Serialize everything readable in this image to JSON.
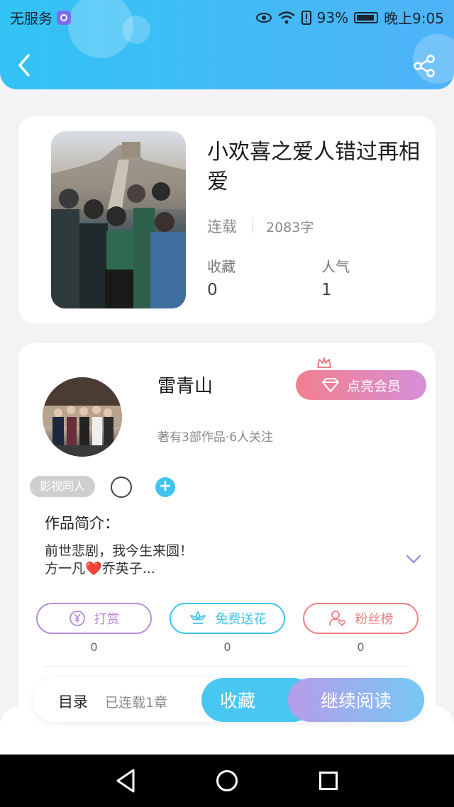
{
  "status_bar": {
    "carrier": "无服务",
    "battery": "93%",
    "time": "晚上9:05"
  },
  "book": {
    "title": "小欢喜之爱人错过再相爱",
    "status": "连载",
    "word_count": "2083字",
    "favorites_label": "收藏",
    "favorites_value": "0",
    "popularity_label": "人气",
    "popularity_value": "1"
  },
  "author": {
    "name": "雷青山",
    "subtitle": "著有3部作品·6人关注",
    "vip_label": "点亮会员",
    "tag": "影视同人",
    "intro_title": "作品简介：",
    "intro_line1": "前世悲剧，我今生来圆！",
    "intro_line2_a": "方一凡",
    "intro_line2_heart": "❤️",
    "intro_line2_b": "乔英子..."
  },
  "actions": [
    {
      "label": "打赏",
      "count": "0",
      "color": "#b78be0"
    },
    {
      "label": "免费送花",
      "count": "0",
      "color": "#3fc3ef"
    },
    {
      "label": "粉丝榜",
      "count": "0",
      "color": "#ee7f82"
    }
  ],
  "bottom_bar": {
    "toc_label": "目录",
    "toc_status": "已连载1章",
    "favorite_label": "收藏",
    "continue_label": "继续阅读"
  },
  "icons": {
    "back": "back-arrow-icon",
    "share": "share-icon",
    "crown": "crown-icon",
    "diamond": "diamond-icon",
    "expand": "chevron-down-icon",
    "yen": "yen-coin-icon",
    "flower": "flower-icon",
    "fans": "user-heart-icon"
  },
  "colors": {
    "header": "#32c3f4",
    "accent_blue": "#48c7f1",
    "vip_gradient_start": "#f27f8d",
    "vip_gradient_end": "#d58fd8"
  }
}
